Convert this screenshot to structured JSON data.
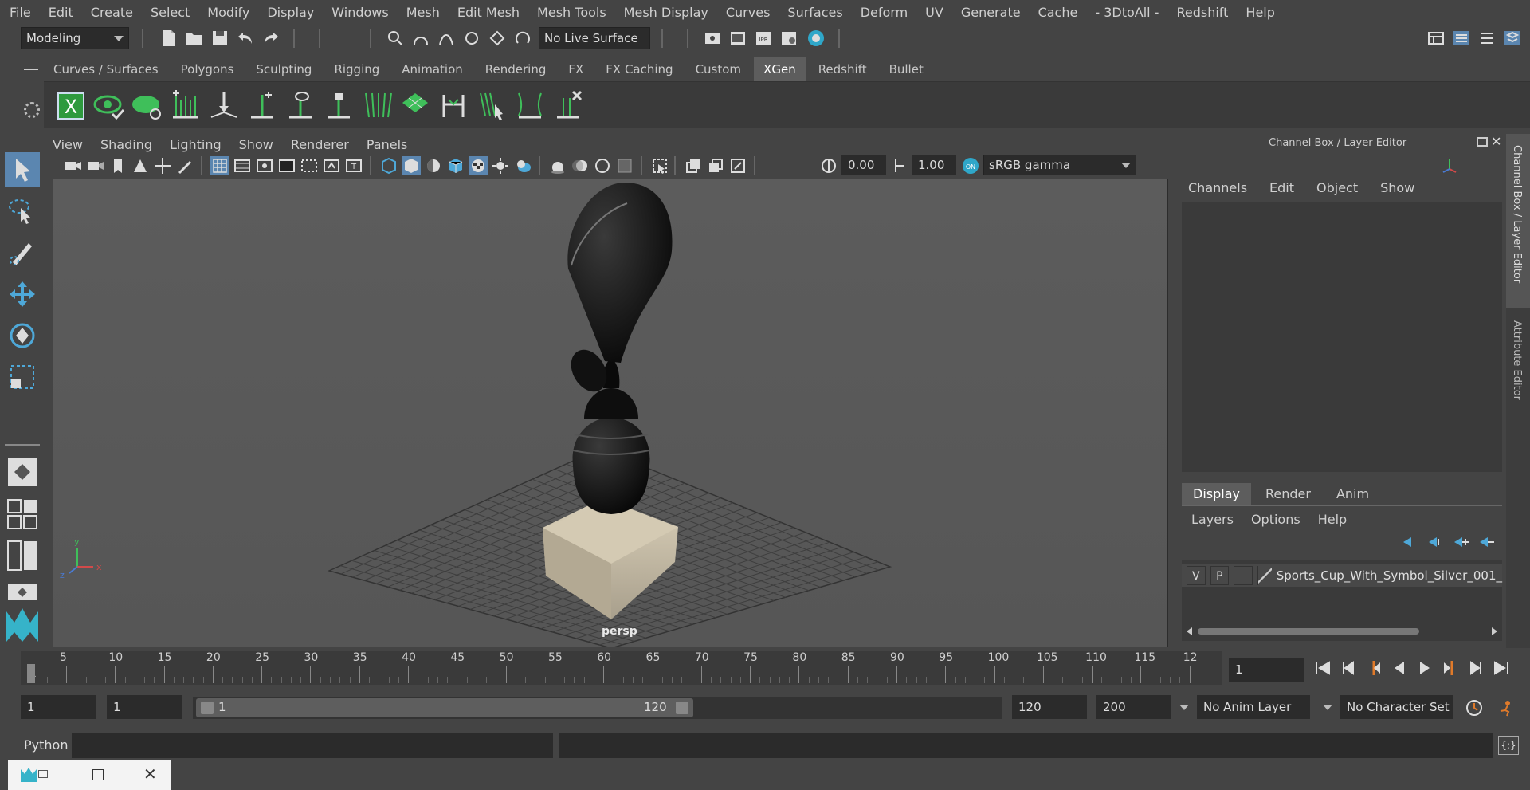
{
  "menubar": [
    "File",
    "Edit",
    "Create",
    "Select",
    "Modify",
    "Display",
    "Windows",
    "Mesh",
    "Edit Mesh",
    "Mesh Tools",
    "Mesh Display",
    "Curves",
    "Surfaces",
    "Deform",
    "UV",
    "Generate",
    "Cache",
    "- 3DtoAll -",
    "Redshift",
    "Help"
  ],
  "statusline": {
    "mode": "Modeling",
    "live_surface": "No Live Surface"
  },
  "shelf": {
    "tabs": [
      "Curves / Surfaces",
      "Polygons",
      "Sculpting",
      "Rigging",
      "Animation",
      "Rendering",
      "FX",
      "FX Caching",
      "Custom",
      "XGen",
      "Redshift",
      "Bullet"
    ],
    "active_tab": "XGen"
  },
  "viewport": {
    "menu": [
      "View",
      "Shading",
      "Lighting",
      "Show",
      "Renderer",
      "Panels"
    ],
    "exposure": "0.00",
    "gamma": "1.00",
    "color_space": "sRGB gamma",
    "camera_label": "persp",
    "axis_x": "x",
    "axis_y": "y",
    "axis_z": "z"
  },
  "channelbox": {
    "title": "Channel Box / Layer Editor",
    "menu": [
      "Channels",
      "Edit",
      "Object",
      "Show"
    ],
    "layer_tabs": [
      "Display",
      "Render",
      "Anim"
    ],
    "active_layer_tab": "Display",
    "layer_menu": [
      "Layers",
      "Options",
      "Help"
    ],
    "layer_row": {
      "v": "V",
      "p": "P",
      "name": "Sports_Cup_With_Symbol_Silver_001_"
    }
  },
  "side_tabs": [
    "Channel Box / Layer Editor",
    "Attribute Editor"
  ],
  "timeline": {
    "ticks": [
      "1",
      "5",
      "10",
      "15",
      "20",
      "25",
      "30",
      "35",
      "40",
      "45",
      "50",
      "55",
      "60",
      "65",
      "70",
      "75",
      "80",
      "85",
      "90",
      "95",
      "100",
      "105",
      "110",
      "115",
      "12"
    ],
    "current_frame": "1"
  },
  "range": {
    "start": "1",
    "playback_start": "1",
    "slider_start": "1",
    "slider_end": "120",
    "playback_end": "120",
    "end": "200",
    "anim_layer": "No Anim Layer",
    "character_set": "No Character Set"
  },
  "cmdline": {
    "label": "Python"
  },
  "colors": {
    "accent": "#5d5d5d",
    "bg": "#444444",
    "viewport": "#5a5a5a",
    "toolbox_highlight": "#5b86b0",
    "xgen_green": "#3fbf5a"
  }
}
